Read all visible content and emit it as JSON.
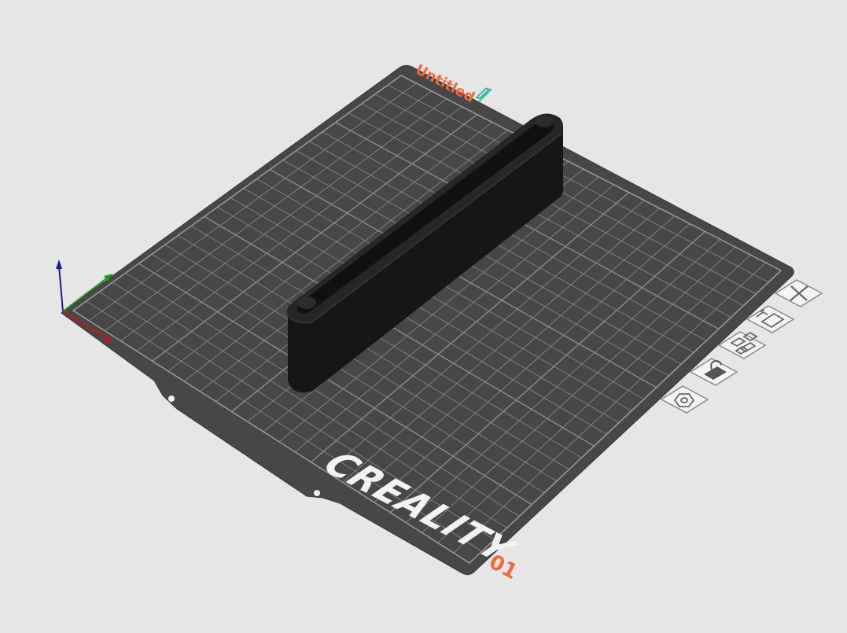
{
  "viewport": {
    "plate": {
      "name": "Untitled",
      "number": "01",
      "brand": "CREALITY"
    }
  },
  "plate_toolbar": {
    "items": [
      {
        "key": "close",
        "icon": "close-icon"
      },
      {
        "key": "auto-orient",
        "icon": "auto-orient-icon"
      },
      {
        "key": "arrange",
        "icon": "arrange-icon"
      },
      {
        "key": "lock",
        "icon": "unlock-icon"
      },
      {
        "key": "settings",
        "icon": "hexagon-settings-icon"
      }
    ]
  },
  "colors": {
    "background": "#e6e6e6",
    "plate": "#474747",
    "grid": "#8a8a8a",
    "accent": "#f0683f",
    "edit": "#3fb8a8",
    "model": "#1a1a1a",
    "axis_x": "#c01818",
    "axis_y": "#1c9a1c",
    "axis_z": "#1a1aa0"
  }
}
